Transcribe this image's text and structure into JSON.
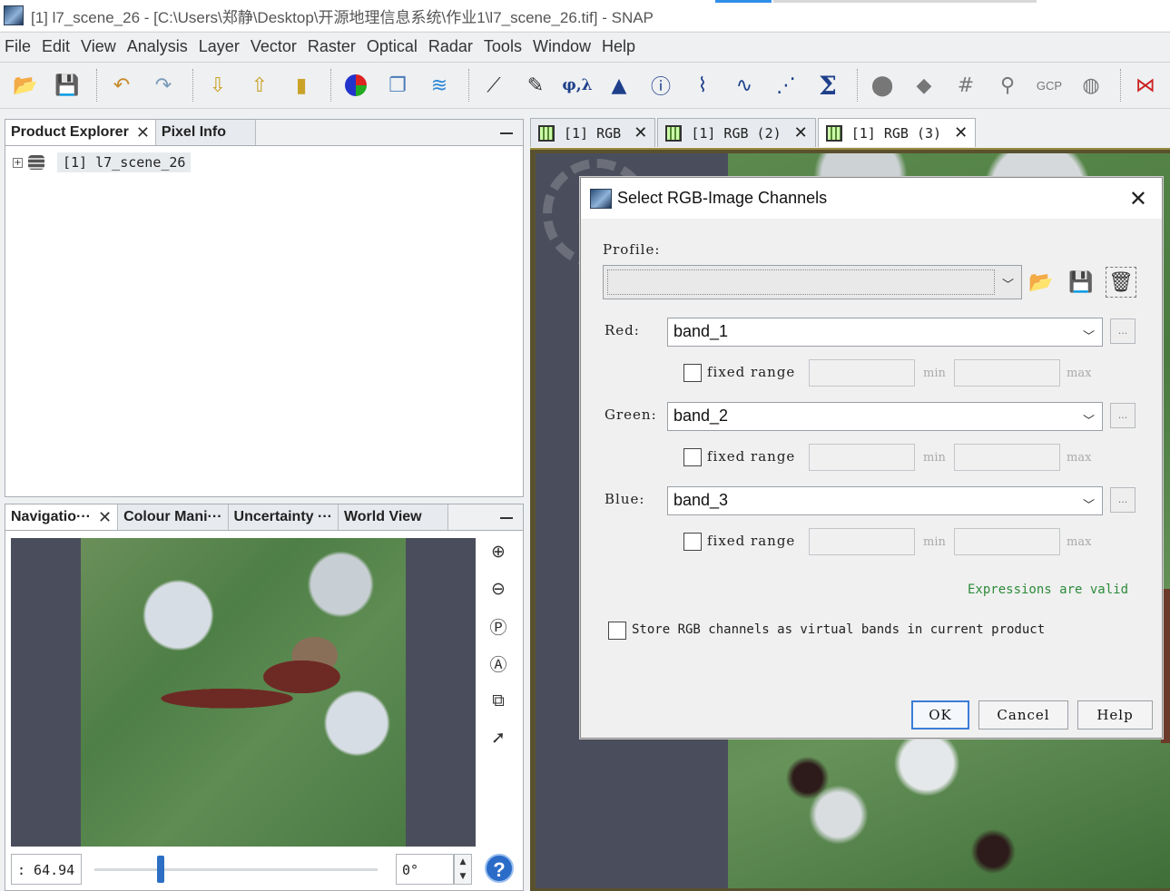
{
  "window": {
    "title": "[1] l7_scene_26 - [C:\\Users\\郑静\\Desktop\\开源地理信息系统\\作业1\\l7_scene_26.tif] - SNAP"
  },
  "menu": [
    "File",
    "Edit",
    "View",
    "Analysis",
    "Layer",
    "Vector",
    "Raster",
    "Optical",
    "Radar",
    "Tools",
    "Window",
    "Help"
  ],
  "toolbar": {
    "icons": [
      "open-product-icon",
      "save-product-icon",
      "undo-icon",
      "redo-icon",
      "import-icon",
      "export-icon",
      "export2-icon",
      "rgb-image-icon",
      "tile-windows-icon",
      "wave-icon",
      "draw-line-icon",
      "edit-icon",
      "geo-coding-icon",
      "histogram-icon",
      "information-icon",
      "pixel-profile-icon",
      "spectrum-icon",
      "scatter-plot-icon",
      "statistics-sigma-icon",
      "mask-icon",
      "layer-icon",
      "grid-icon",
      "pin-icon",
      "gcp-icon",
      "product-library-icon",
      "graph-builder-icon"
    ],
    "phi_lambda": "φ,λ",
    "sigma": "Σ",
    "gcp": "GCP"
  },
  "product_explorer": {
    "tabs": [
      "Product Explorer",
      "Pixel Info"
    ],
    "product_label": "[1] l7_scene_26"
  },
  "navigation_panel": {
    "tabs": [
      "Navigatio···",
      "Colour Mani···",
      "Uncertainty ···",
      "World View"
    ],
    "zoom_value": ": 64.94",
    "slider_position": 0.22,
    "angle_value": "0°",
    "help_symbol": "?"
  },
  "document_tabs": [
    "[1] RGB",
    "[1] RGB (2)",
    "[1] RGB (3)"
  ],
  "dialog": {
    "title": "Select RGB-Image Channels",
    "profile_label": "Profile:",
    "profile_value": "",
    "red_label": "Red:",
    "red_value": "band_1",
    "green_label": "Green:",
    "green_value": "band_2",
    "blue_label": "Blue:",
    "blue_value": "band_3",
    "fixed_range": "fixed range",
    "min_label": "min",
    "max_label": "max",
    "dots_label": "...",
    "valid_text": "Expressions are valid",
    "store_label": "Store RGB channels as virtual bands in current product",
    "ok": "OK",
    "cancel": "Cancel",
    "help": "Help"
  },
  "colors": {
    "valid_green": "#2e8b3b",
    "ok_border": "#3b7dd8"
  }
}
